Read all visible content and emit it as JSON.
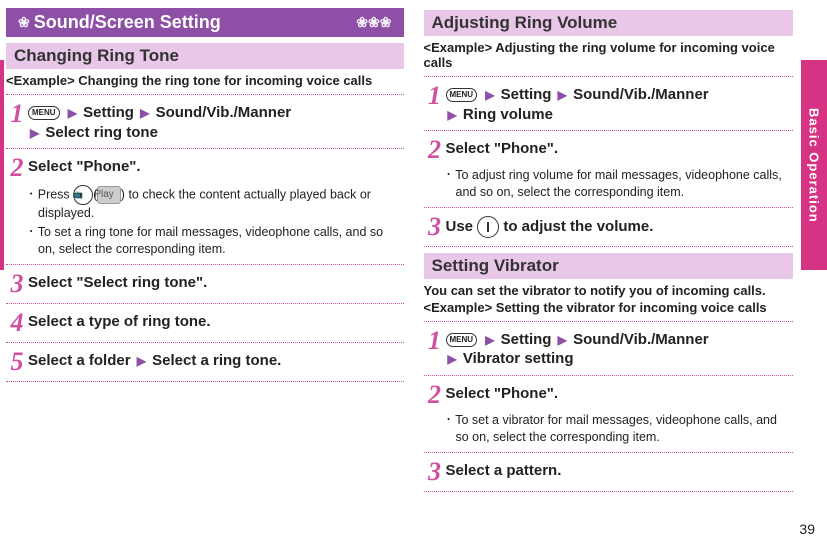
{
  "banner": {
    "title": "Sound/Screen Setting"
  },
  "right_tab": "Basic Operation",
  "page_number": "39",
  "left": {
    "h1": "Changing Ring Tone",
    "example": "<Example> Changing the ring tone for incoming voice calls",
    "steps": {
      "s1": {
        "num": "1",
        "menu": "MENU",
        "setting": "Setting",
        "path1": "Sound/Vib./Manner",
        "path2": "Select ring tone"
      },
      "s2": {
        "num": "2",
        "title": "Select \"Phone\".",
        "note1_pre": "Press ",
        "note1_tv": "📺",
        "note1_play": "Play",
        "note1_post": " to check the content actually played back or displayed.",
        "note2": "To set a ring tone for mail messages, videophone calls, and so on, select the corresponding item."
      },
      "s3": {
        "num": "3",
        "title": "Select \"Select ring tone\"."
      },
      "s4": {
        "num": "4",
        "title": "Select a type of ring tone."
      },
      "s5": {
        "num": "5",
        "title_a": "Select a folder",
        "title_b": "Select a ring tone."
      }
    }
  },
  "right": {
    "h1": "Adjusting Ring Volume",
    "example1": "<Example> Adjusting the ring volume for incoming voice calls",
    "steps1": {
      "s1": {
        "num": "1",
        "menu": "MENU",
        "setting": "Setting",
        "path1": "Sound/Vib./Manner",
        "path2": "Ring volume"
      },
      "s2": {
        "num": "2",
        "title": "Select \"Phone\".",
        "note1": "To adjust ring volume for mail messages, videophone calls, and so on, select the corresponding item."
      },
      "s3": {
        "num": "3",
        "title_a": "Use ",
        "title_b": " to adjust the volume."
      }
    },
    "h2": "Setting Vibrator",
    "lead": "You can set the vibrator to notify you of incoming calls.",
    "example2": "<Example> Setting the vibrator for incoming voice calls",
    "steps2": {
      "s1": {
        "num": "1",
        "menu": "MENU",
        "setting": "Setting",
        "path1": "Sound/Vib./Manner",
        "path2": "Vibrator setting"
      },
      "s2": {
        "num": "2",
        "title": "Select \"Phone\".",
        "note1": "To set a vibrator for mail messages, videophone calls, and so on, select the corresponding item."
      },
      "s3": {
        "num": "3",
        "title": "Select a pattern."
      }
    }
  }
}
